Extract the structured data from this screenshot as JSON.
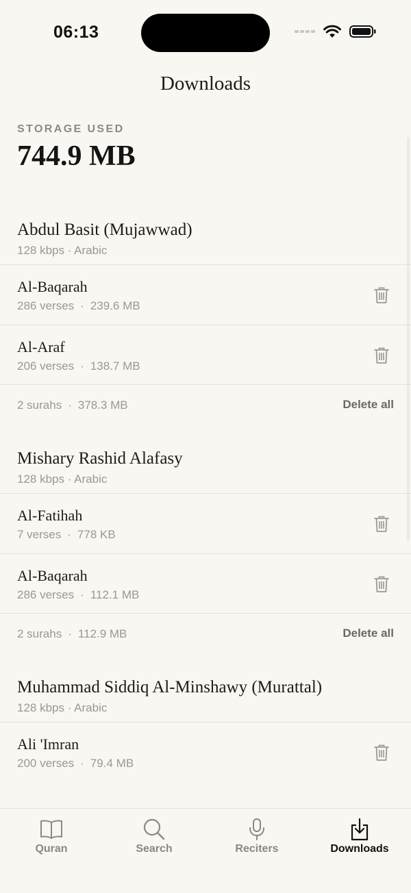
{
  "status_bar": {
    "time": "06:13"
  },
  "header": {
    "title": "Downloads"
  },
  "storage": {
    "label": "STORAGE USED",
    "value": "744.9 MB"
  },
  "sections": [
    {
      "reciter": "Abdul Basit (Mujawwad)",
      "meta": "128 kbps · Arabic",
      "items": [
        {
          "surah": "Al-Baqarah",
          "verses": "286 verses",
          "size": "239.6 MB"
        },
        {
          "surah": "Al-Araf",
          "verses": "206 verses",
          "size": "138.7 MB"
        }
      ],
      "summary": {
        "count": "2 surahs",
        "total": "378.3 MB"
      },
      "delete_all": "Delete all"
    },
    {
      "reciter": "Mishary Rashid Alafasy",
      "meta": "128 kbps · Arabic",
      "items": [
        {
          "surah": "Al-Fatihah",
          "verses": "7 verses",
          "size": "778 KB"
        },
        {
          "surah": "Al-Baqarah",
          "verses": "286 verses",
          "size": "112.1 MB"
        }
      ],
      "summary": {
        "count": "2 surahs",
        "total": "112.9 MB"
      },
      "delete_all": "Delete all"
    },
    {
      "reciter": "Muhammad Siddiq Al-Minshawy (Murattal)",
      "meta": "128 kbps · Arabic",
      "items": [
        {
          "surah": "Ali 'Imran",
          "verses": "200 verses",
          "size": "79.4 MB"
        }
      ]
    }
  ],
  "separator": "·",
  "tabs": [
    {
      "label": "Quran",
      "icon": "book-icon"
    },
    {
      "label": "Search",
      "icon": "search-icon"
    },
    {
      "label": "Reciters",
      "icon": "microphone-icon"
    },
    {
      "label": "Downloads",
      "icon": "download-icon",
      "active": true
    }
  ]
}
